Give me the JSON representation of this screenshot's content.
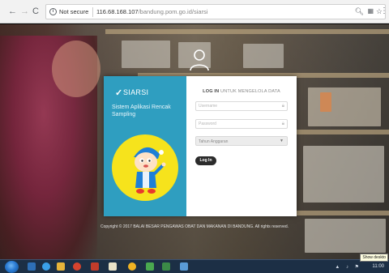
{
  "browser": {
    "back_icon": "arrow-left-icon",
    "forward_icon": "arrow-right-icon",
    "reload_icon": "reload-icon",
    "security_label": "Not secure",
    "url_host": "116.68.168.107",
    "url_path": "/bandung.pom.go.id/siarsi"
  },
  "brand": {
    "name": "SIARSI",
    "tagline": "Sistem Aplikasi Rencak Sampling"
  },
  "login": {
    "title_bold": "LOG IN",
    "title_rest": " UNTUK MENGELOLA DATA",
    "username_placeholder": "Username",
    "password_placeholder": "Password",
    "year_select_label": "Tahun Anggaran",
    "button_label": "Log In"
  },
  "footer": {
    "copyright": "Copyright © 2017 BALAI BESAR PENGAWAS OBAT DAN MAKANAN DI BANDUNG. All rights reserved."
  },
  "taskbar": {
    "tooltip": "Show deskto",
    "clock": "11:00"
  },
  "colors": {
    "panel_left": "#2f9ec0",
    "mascot_bg": "#f6e31c",
    "login_button": "#2b2b2b"
  }
}
